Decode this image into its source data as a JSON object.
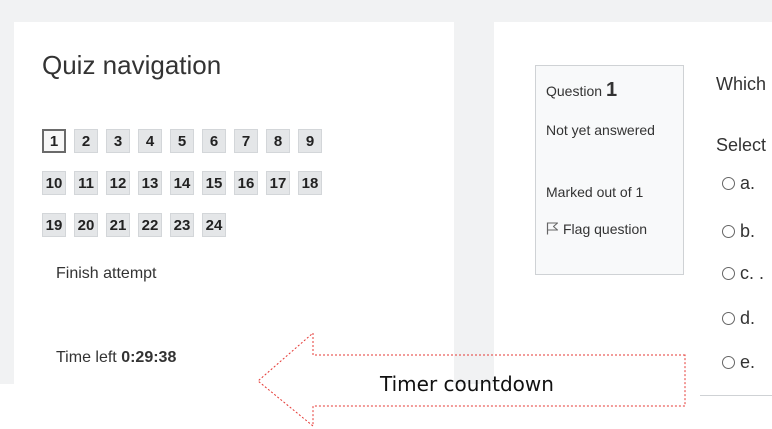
{
  "navigation": {
    "title": "Quiz navigation",
    "rows": [
      [
        "1",
        "2",
        "3",
        "4",
        "5",
        "6",
        "7",
        "8",
        "9"
      ],
      [
        "10",
        "11",
        "12",
        "13",
        "14",
        "15",
        "16",
        "17",
        "18"
      ],
      [
        "19",
        "20",
        "21",
        "22",
        "23",
        "24"
      ]
    ],
    "current_question": "1",
    "finish_label": "Finish attempt",
    "time_left_label": "Time left",
    "time_left_value": "0:29:38"
  },
  "question": {
    "label": "Question",
    "number": "1",
    "state": "Not yet answered",
    "grade": "Marked out of 1",
    "flag_label": "Flag question",
    "text": "Which",
    "prompt": "Select",
    "options": [
      "a.",
      "b.",
      "c. .",
      "d.",
      "e."
    ]
  },
  "annotation": {
    "label": "Timer countdown",
    "color": "#e53935"
  },
  "colors": {
    "background": "#f1f2f3",
    "panel": "#ffffff",
    "nav_button": "#e4e6e8",
    "info_box": "#f8f9fa"
  }
}
